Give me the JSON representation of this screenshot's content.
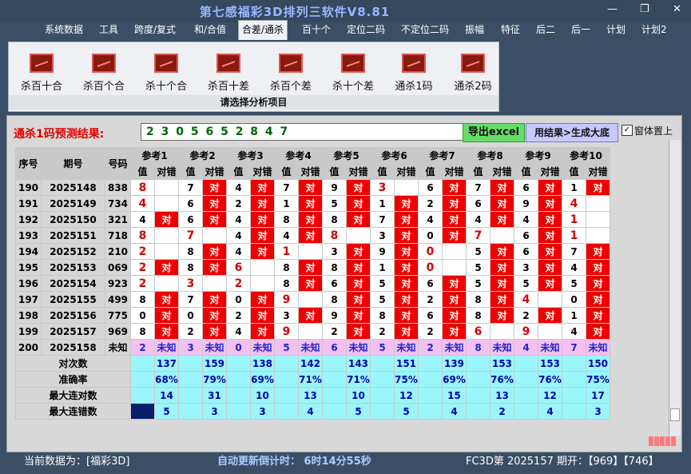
{
  "window": {
    "title": "第七感福彩3D排列三软件V8.81"
  },
  "menu": [
    "系统数据",
    "工具",
    "跨度/复式",
    "和/合值",
    "合差/通杀",
    "百十个",
    "定位二码",
    "不定位二码",
    "振幅",
    "特征",
    "后二",
    "后一",
    "计划",
    "计划2"
  ],
  "ribbon": {
    "buttons": [
      "杀百十合",
      "杀百个合",
      "杀十个合",
      "杀百十差",
      "杀百个差",
      "杀十个差",
      "通杀1码",
      "通杀2码"
    ],
    "caption": "请选择分析项目"
  },
  "prediction": {
    "label": "通杀1码预测结果:",
    "numbers": "2 3 0 5 6 5 2 8 4 7",
    "excel_button": "导出excel",
    "gen_button": "用结果>生成大底",
    "pin_label": "窗体置上"
  },
  "table": {
    "head_seq": "序号",
    "head_period": "期号",
    "head_code": "号码",
    "refs": [
      "参考1",
      "参考2",
      "参考3",
      "参考4",
      "参考5",
      "参考6",
      "参考7",
      "参考8",
      "参考9",
      "参考10"
    ],
    "sub_val": "值",
    "sub_hit": "对错",
    "hit_text": "对",
    "unknown_text": "未知",
    "rows": [
      {
        "seq": "190",
        "period": "2025148",
        "code": "838",
        "vals": [
          "8",
          "7",
          "4",
          "7",
          "9",
          "3",
          "6",
          "7",
          "6",
          "1"
        ],
        "hits": [
          0,
          1,
          1,
          1,
          1,
          0,
          1,
          1,
          1,
          1
        ],
        "red": [
          1,
          0,
          0,
          0,
          0,
          1,
          0,
          0,
          0,
          0
        ]
      },
      {
        "seq": "191",
        "period": "2025149",
        "code": "734",
        "vals": [
          "4",
          "6",
          "2",
          "1",
          "5",
          "1",
          "2",
          "6",
          "9",
          "4"
        ],
        "hits": [
          0,
          1,
          1,
          1,
          1,
          1,
          1,
          1,
          1,
          0
        ],
        "red": [
          1,
          0,
          0,
          0,
          0,
          0,
          0,
          0,
          0,
          1
        ]
      },
      {
        "seq": "192",
        "period": "2025150",
        "code": "321",
        "vals": [
          "4",
          "6",
          "4",
          "8",
          "8",
          "7",
          "4",
          "4",
          "4",
          "1"
        ],
        "hits": [
          1,
          1,
          1,
          1,
          1,
          1,
          1,
          1,
          1,
          0
        ],
        "red": [
          0,
          0,
          0,
          0,
          0,
          0,
          0,
          0,
          0,
          1
        ]
      },
      {
        "seq": "193",
        "period": "2025151",
        "code": "718",
        "vals": [
          "8",
          "7",
          "4",
          "4",
          "8",
          "3",
          "0",
          "7",
          "6",
          "1"
        ],
        "hits": [
          0,
          0,
          1,
          1,
          0,
          1,
          1,
          0,
          1,
          0
        ],
        "red": [
          1,
          1,
          0,
          0,
          1,
          0,
          0,
          1,
          0,
          1
        ]
      },
      {
        "seq": "194",
        "period": "2025152",
        "code": "210",
        "vals": [
          "2",
          "8",
          "4",
          "1",
          "3",
          "9",
          "0",
          "5",
          "6",
          "7"
        ],
        "hits": [
          0,
          1,
          1,
          0,
          1,
          1,
          0,
          1,
          1,
          1
        ],
        "red": [
          1,
          0,
          0,
          1,
          0,
          0,
          1,
          0,
          0,
          0
        ]
      },
      {
        "seq": "195",
        "period": "2025153",
        "code": "069",
        "vals": [
          "2",
          "8",
          "6",
          "8",
          "8",
          "1",
          "0",
          "5",
          "3",
          "4"
        ],
        "hits": [
          1,
          1,
          0,
          1,
          1,
          1,
          0,
          1,
          1,
          1
        ],
        "red": [
          1,
          0,
          1,
          0,
          0,
          0,
          1,
          0,
          0,
          0
        ]
      },
      {
        "seq": "196",
        "period": "2025154",
        "code": "923",
        "vals": [
          "2",
          "3",
          "2",
          "8",
          "6",
          "5",
          "6",
          "5",
          "5",
          "5"
        ],
        "hits": [
          0,
          0,
          0,
          1,
          1,
          1,
          1,
          1,
          1,
          1
        ],
        "red": [
          1,
          1,
          1,
          0,
          0,
          0,
          0,
          0,
          0,
          0
        ]
      },
      {
        "seq": "197",
        "period": "2025155",
        "code": "499",
        "vals": [
          "8",
          "7",
          "0",
          "9",
          "8",
          "5",
          "2",
          "8",
          "4",
          "0"
        ],
        "hits": [
          1,
          1,
          1,
          0,
          1,
          1,
          1,
          1,
          0,
          1
        ],
        "red": [
          0,
          0,
          0,
          1,
          0,
          0,
          0,
          0,
          1,
          0
        ]
      },
      {
        "seq": "198",
        "period": "2025156",
        "code": "775",
        "vals": [
          "0",
          "0",
          "2",
          "3",
          "9",
          "8",
          "6",
          "8",
          "2",
          "1"
        ],
        "hits": [
          1,
          1,
          1,
          1,
          1,
          1,
          1,
          1,
          1,
          1
        ],
        "red": [
          0,
          0,
          0,
          0,
          0,
          0,
          0,
          0,
          0,
          0
        ]
      },
      {
        "seq": "199",
        "period": "2025157",
        "code": "969",
        "vals": [
          "8",
          "2",
          "4",
          "9",
          "2",
          "2",
          "2",
          "6",
          "9",
          "4"
        ],
        "hits": [
          1,
          1,
          1,
          0,
          1,
          1,
          1,
          0,
          0,
          1
        ],
        "red": [
          0,
          0,
          0,
          1,
          0,
          0,
          0,
          1,
          1,
          0
        ]
      },
      {
        "seq": "200",
        "period": "2025158",
        "code": "未知",
        "vals": [
          "2",
          "3",
          "0",
          "5",
          "6",
          "5",
          "2",
          "8",
          "4",
          "7"
        ],
        "hits": [],
        "red": []
      }
    ],
    "stats": [
      {
        "label": "对次数",
        "values": [
          "137",
          "159",
          "138",
          "142",
          "143",
          "151",
          "139",
          "153",
          "153",
          "150"
        ]
      },
      {
        "label": "准确率",
        "values": [
          "68%",
          "79%",
          "69%",
          "71%",
          "71%",
          "75%",
          "69%",
          "76%",
          "76%",
          "75%"
        ]
      },
      {
        "label": "最大连对数",
        "values": [
          "14",
          "31",
          "10",
          "13",
          "10",
          "12",
          "15",
          "13",
          "12",
          "17"
        ]
      },
      {
        "label": "最大连错数",
        "values": [
          "5",
          "3",
          "3",
          "4",
          "5",
          "5",
          "4",
          "2",
          "4",
          "3"
        ]
      }
    ]
  },
  "status": {
    "current": "当前数据为：[福彩3D]",
    "countdown": "自动更新倒计时：  6时14分55秒",
    "draw": "FC3D第 2025157 期开：【969】【746】"
  }
}
